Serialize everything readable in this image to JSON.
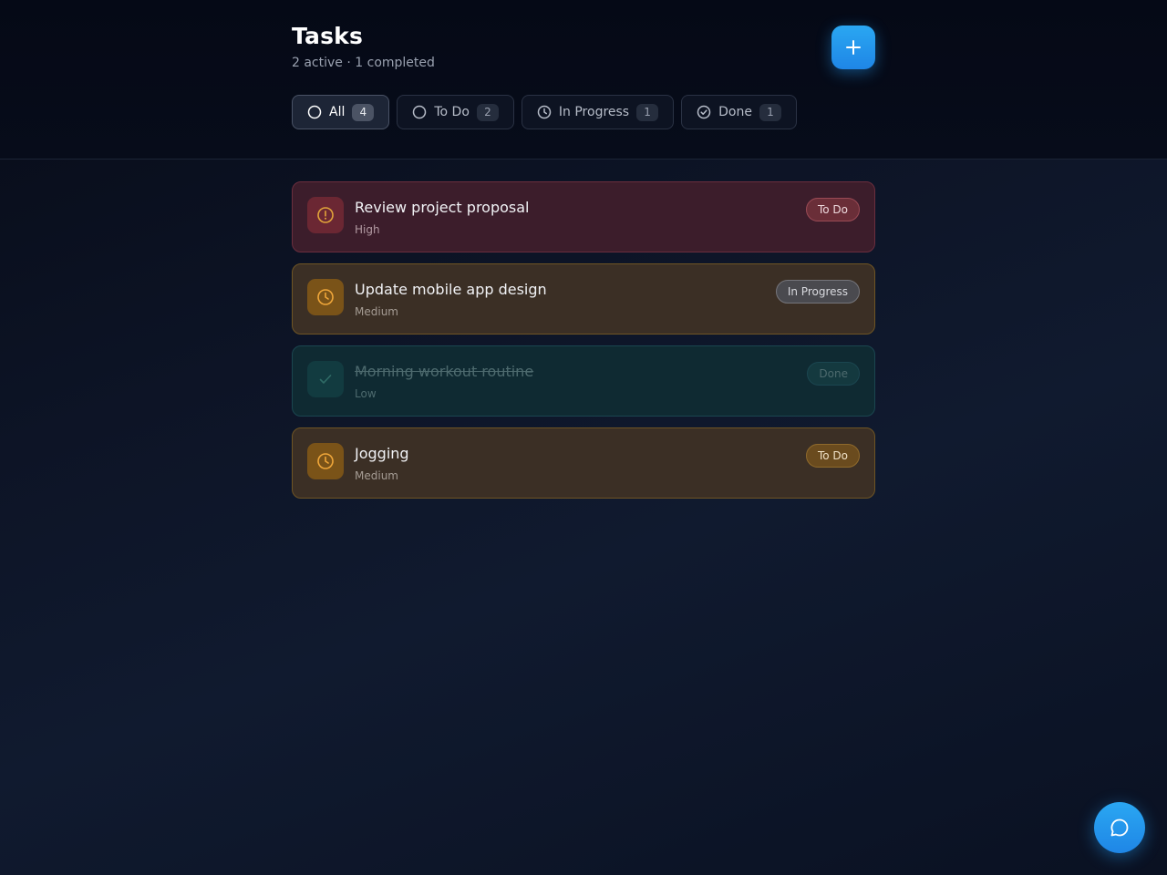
{
  "header": {
    "title": "Tasks",
    "subtitle": "2 active · 1 completed"
  },
  "filters": [
    {
      "label": "All",
      "count": "4",
      "icon": "circle-icon",
      "active": true
    },
    {
      "label": "To Do",
      "count": "2",
      "icon": "circle-icon",
      "active": false
    },
    {
      "label": "In Progress",
      "count": "1",
      "icon": "clock-icon",
      "active": false
    },
    {
      "label": "Done",
      "count": "1",
      "icon": "check-circle-icon",
      "active": false
    }
  ],
  "tasks": [
    {
      "title": "Review project proposal",
      "priority": "High",
      "status": "To Do",
      "icon": "alert-circle-icon",
      "color": "#e2a43a"
    },
    {
      "title": "Update mobile app design",
      "priority": "Medium",
      "status": "In Progress",
      "icon": "clock-icon",
      "color": "#f0a73a"
    },
    {
      "title": "Morning workout routine",
      "priority": "Low",
      "status": "Done",
      "icon": "check-icon",
      "color": "#2f6b66"
    },
    {
      "title": "Jogging",
      "priority": "Medium",
      "status": "To Do",
      "icon": "clock-icon",
      "color": "#f0a73a"
    }
  ],
  "colors": {
    "accent": "#2196ea",
    "high": "#3c1d2b",
    "medium": "#3b2f25",
    "low": "#0f2a32"
  }
}
